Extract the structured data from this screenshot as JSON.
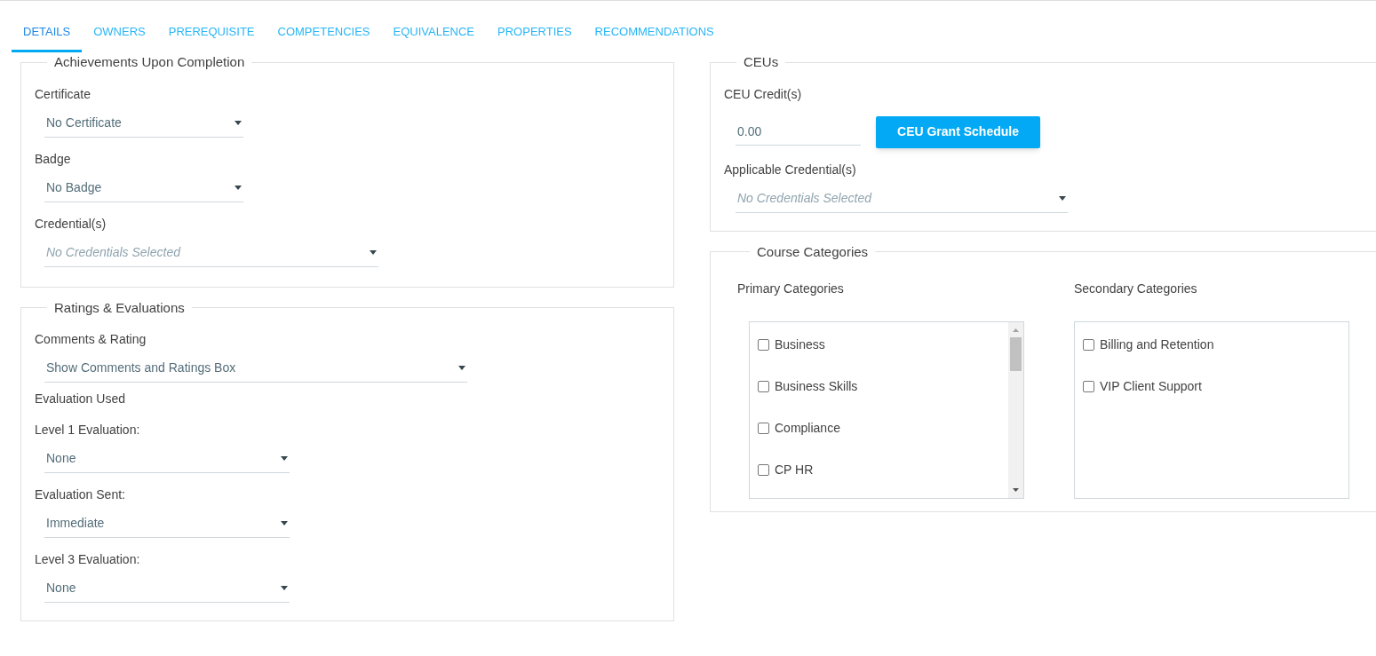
{
  "tabs": [
    {
      "label": "DETAILS",
      "selected": true
    },
    {
      "label": "OWNERS",
      "selected": false
    },
    {
      "label": "PREREQUISITE",
      "selected": false
    },
    {
      "label": "COMPETENCIES",
      "selected": false
    },
    {
      "label": "EQUIVALENCE",
      "selected": false
    },
    {
      "label": "PROPERTIES",
      "selected": false
    },
    {
      "label": "RECOMMENDATIONS",
      "selected": false
    }
  ],
  "achievements": {
    "title": "Achievements Upon Completion",
    "fields": [
      {
        "kind": "select",
        "label": "Certificate",
        "value": "No Certificate"
      },
      {
        "kind": "select",
        "label": "Badge",
        "value": "No Badge"
      },
      {
        "kind": "select",
        "label": "Credential(s)",
        "placeholder": "No Credentials Selected"
      }
    ]
  },
  "ratings": {
    "title": "Ratings & Evaluations",
    "fields": [
      {
        "kind": "select",
        "label": "Comments & Rating",
        "value": "Show Comments and Ratings Box"
      },
      {
        "kind": "heading",
        "label": "Evaluation Used"
      },
      {
        "kind": "select",
        "label": "Level 1 Evaluation:",
        "value": "None"
      },
      {
        "kind": "select",
        "label": "Evaluation Sent:",
        "value": "Immediate"
      },
      {
        "kind": "select",
        "label": "Level 3 Evaluation:",
        "value": "None"
      }
    ]
  },
  "ceus": {
    "title": "CEUs",
    "credit_label": "CEU Credit(s)",
    "credit_value": "0.00",
    "button": "CEU Grant Schedule",
    "credential_label": "Applicable Credential(s)",
    "credential_placeholder": "No Credentials Selected"
  },
  "categories": {
    "title": "Course Categories",
    "primary": {
      "label": "Primary Categories",
      "items": [
        {
          "label": "Business",
          "checked": false
        },
        {
          "label": "Business Skills",
          "checked": false
        },
        {
          "label": "Compliance",
          "checked": false
        },
        {
          "label": "CP HR",
          "checked": false
        }
      ]
    },
    "secondary": {
      "label": "Secondary Categories",
      "items": [
        {
          "label": "Billing and Retention",
          "checked": false
        },
        {
          "label": "VIP Client Support",
          "checked": false
        }
      ]
    }
  }
}
